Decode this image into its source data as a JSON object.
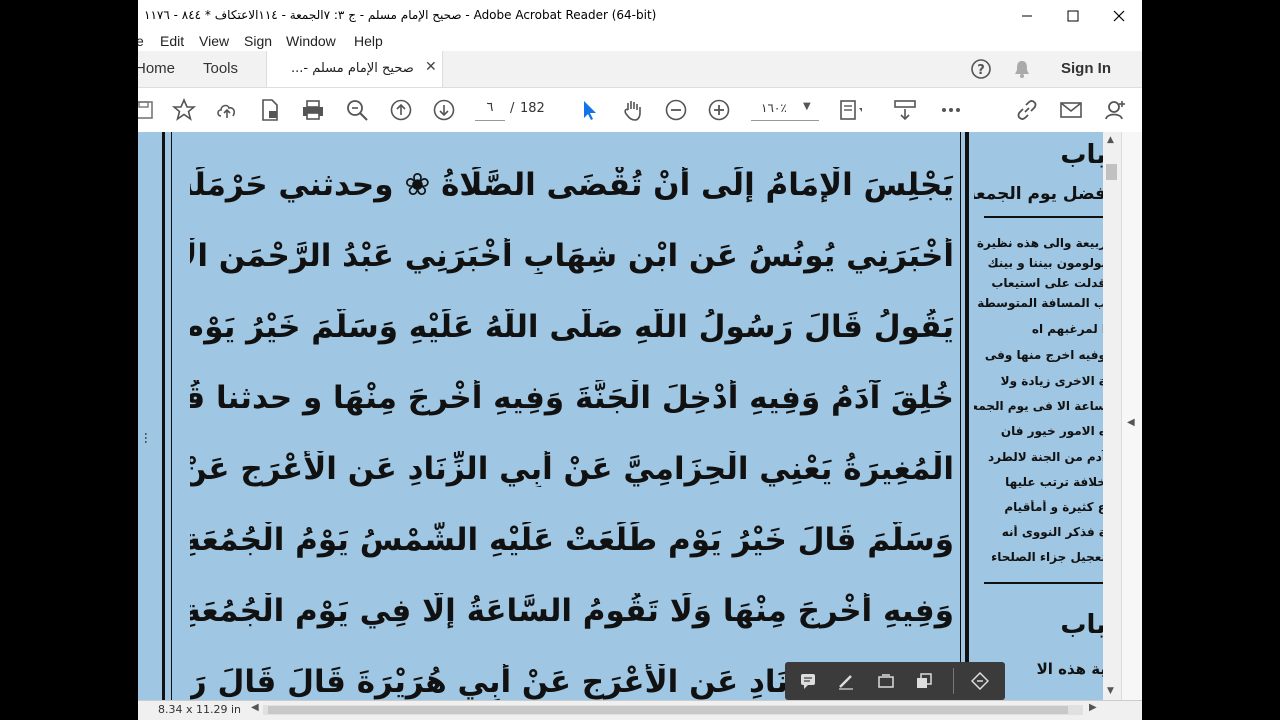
{
  "window": {
    "title": "صحيح الإمام مسلم - ج ٣: ٧الجمعة - ١١٤الاعتكاف * ٨٤٤ - ١١٧٦ - Adobe Acrobat Reader (64-bit)"
  },
  "menubar": {
    "items": [
      "e",
      "Edit",
      "View",
      "Sign",
      "Window",
      "Help"
    ]
  },
  "tabs": {
    "home": "Home",
    "tools": "Tools",
    "document": "صحيح الإمام مسلم -...",
    "sign_in": "Sign In"
  },
  "toolbar": {
    "page_current": "٦",
    "page_sep": "/",
    "page_total": "182",
    "zoom": "١٦٠٪"
  },
  "document": {
    "lines": [
      "يَجْلِسَ الْإِمَامُ إِلَى أَنْ تُقْضَى الصَّلَاةُ ❀ وحدثني حَرْمَلَةُ بْنُ يَحْيَى أَخْبَرَنَا ابْنُ وَهْبٍ",
      "أَخْبَرَنِي يُونُسُ عَنِ ابْنِ شِهَابٍ أَخْبَرَنِي عَبْدُ الرَّحْمَنِ الْأَعْرَجُ أَنَّهُ سَمِعَ أَبَا هُرَيْرَةَ",
      "يَقُولُ قَالَ رَسُولُ اللَّهِ صَلَّى اللَّهُ عَلَيْهِ وَسَلَّمَ خَيْرُ يَوْمٍ طَلَعَتْ عَلَيْهِ الشَّمْسُ يَوْمُ الْجُمُعَةِ فِيهِ",
      "خُلِقَ آدَمُ وَفِيهِ أُدْخِلَ الْجَنَّةَ وَفِيهِ أُخْرِجَ مِنْهَا و حدثنا قُتَيْبَةُ بْنُ سَعِيدٍ حَدَّثَنَا",
      "الْمُغِيرَةُ يَعْنِي الْحِزَامِيَّ عَنْ أَبِي الزِّنَادِ عَنِ الْأَعْرَجِ عَنْ أَبِي هُرَيْرَةَ أَنَّ النَّبِيَّ صَلَّى اللَّهُ عَلَيْهِ",
      "وَسَلَّمَ قَالَ خَيْرُ يَوْمٍ طَلَعَتْ عَلَيْهِ الشَّمْسُ يَوْمُ الْجُمُعَةِ فِيهِ خُلِقَ آدَمُ وَفِيهِ أُدْخِلَ الْجَنَّةَ",
      "وَفِيهِ أُخْرِجَ مِنْهَا وَلَا تَقُومُ السَّاعَةُ إِلَّا فِي يَوْمِ الْجُمُعَةِ ❀ و حدثنا عَمْرٌو النَّاقِدُ حَدَّثَنَا",
      "عَنْ أَبِي الزِّنَادِ عَنِ الْأَعْرَجِ عَنْ أَبِي هُرَيْرَةَ قَالَ قَالَ رَسُولُ اللَّهِ"
    ],
    "margin_heading_1": "باب",
    "margin_heading_1_sub": "فضل يوم الجمعة",
    "margin_lines": [
      "ربيعة والى هذه نظيرة",
      "يولومون بيننا و بينك",
      "قدلت على استيعاب",
      "ب المسافة المتوسطة",
      "ا لمرغبهم اه",
      "وفيه اخرج منها وفى",
      "ة الاخرى زيادة ولا",
      "ساعة الا فى يوم الجمعة",
      "ه الامور خيور فان",
      "آدم من الجنة لالطرد",
      "خلافة ترتب عليها",
      "ع كثيرة و أمأقيام",
      "ة فذكر النووى أنه",
      "تعجيل جزاء الصلحاء"
    ],
    "margin_heading_2": "باب",
    "margin_lines_2": [
      "ية هذه الا"
    ]
  },
  "statusbar": {
    "page_size": "8.34 x 11.29 in"
  }
}
